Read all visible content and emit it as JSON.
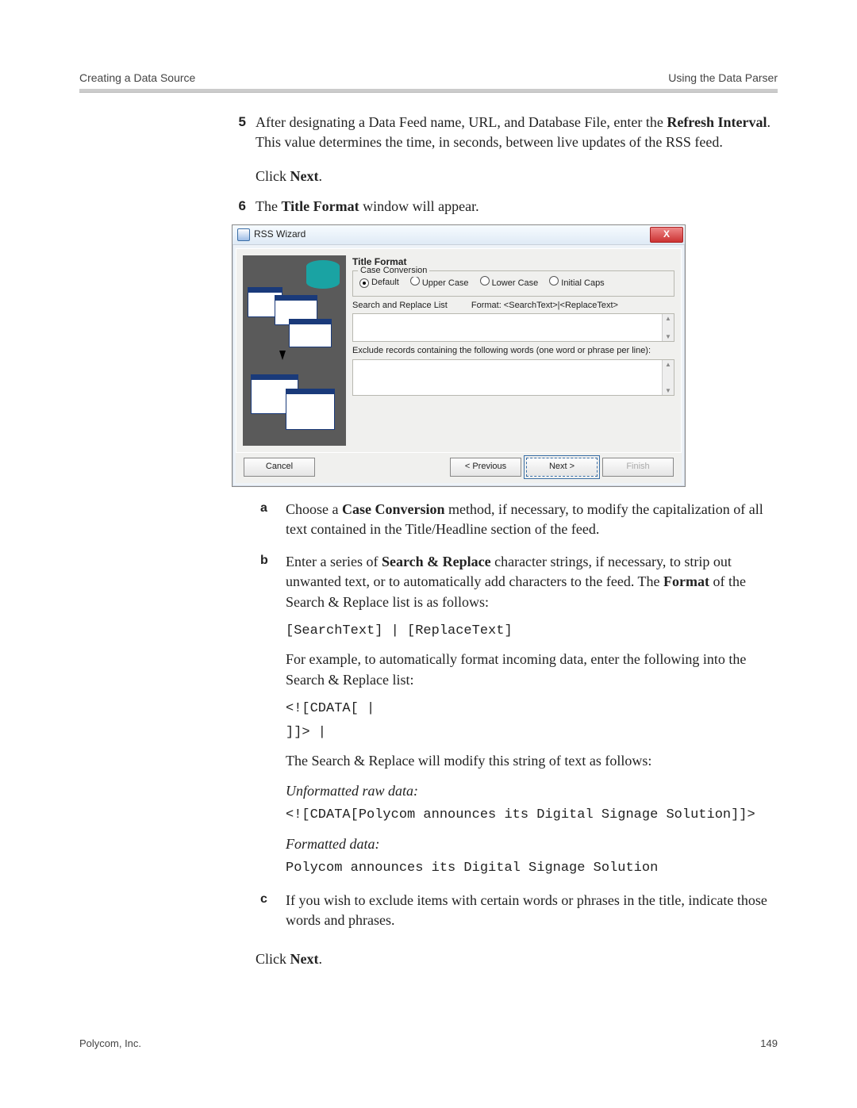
{
  "header": {
    "left": "Creating a Data Source",
    "right": "Using the Data Parser"
  },
  "steps": {
    "s5": {
      "num": "5",
      "p1a": "After designating a Data Feed name, URL, and Database File, enter the ",
      "p1b": "Refresh Interval",
      "p1c": ". This value determines the time, in seconds, between live updates of the RSS feed.",
      "p2a": "Click ",
      "p2b": "Next",
      "p2c": "."
    },
    "s6": {
      "num": "6",
      "p1a": "The ",
      "p1b": "Title Format",
      "p1c": " window will appear."
    }
  },
  "dialog": {
    "title": "RSS Wizard",
    "close": "X",
    "section_title": "Title Format",
    "group_legend": "Case Conversion",
    "radios": {
      "default": "Default",
      "upper": "Upper Case",
      "lower": "Lower Case",
      "initial": "Initial Caps"
    },
    "sr_label": "Search and Replace List",
    "sr_format": "Format: <SearchText>|<ReplaceText>",
    "exclude_label": "Exclude records containing the following words (one word or phrase per line):",
    "buttons": {
      "cancel": "Cancel",
      "prev": "< Previous",
      "next": "Next >",
      "finish": "Finish"
    }
  },
  "sub": {
    "a": {
      "letter": "a",
      "t1": "Choose a ",
      "t2": "Case Conversion",
      "t3": " method, if necessary, to modify the capitalization of all text contained in the Title/Headline section of the feed."
    },
    "b": {
      "letter": "b",
      "t1": "Enter a series of ",
      "t2": "Search & Replace",
      "t3": " character strings, if necessary, to strip out unwanted text, or to automatically add characters to the feed. The ",
      "t4": "Format",
      "t5": " of the Search & Replace list is as follows:",
      "code1": "[SearchText] | [ReplaceText]",
      "p2": "For example, to automatically format incoming data, enter the following into the Search & Replace list:",
      "code2a": "<![CDATA[ |",
      "code2b": "]]> |",
      "p3": "The Search & Replace will modify this string of text as follows:",
      "it1": "Unformatted raw data:",
      "code3": "<![CDATA[Polycom announces its Digital Signage Solution]]>",
      "it2": "Formatted data:",
      "code4": "Polycom announces its Digital Signage Solution"
    },
    "c": {
      "letter": "c",
      "t1": "If you wish to exclude items with certain words or phrases in the title, indicate those words and phrases."
    },
    "final": {
      "t1": "Click ",
      "t2": "Next",
      "t3": "."
    }
  },
  "footer": {
    "left": "Polycom, Inc.",
    "right": "149"
  }
}
